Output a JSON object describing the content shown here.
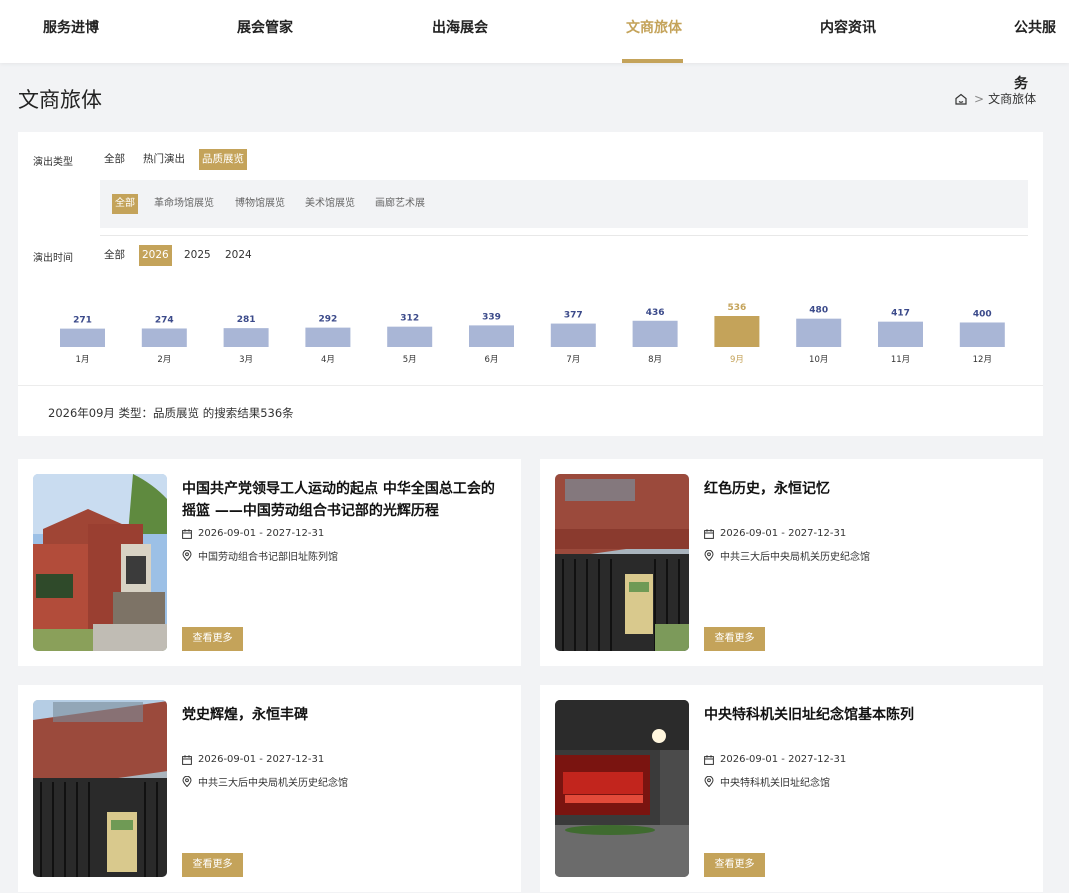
{
  "nav": {
    "items": [
      {
        "label": "服务进博",
        "active": false
      },
      {
        "label": "展会管家",
        "active": false
      },
      {
        "label": "出海展会",
        "active": false
      },
      {
        "label": "文商旅体",
        "active": true
      },
      {
        "label": "内容资讯",
        "active": false
      },
      {
        "label": "公共服务",
        "active": false
      }
    ]
  },
  "page": {
    "title": "文商旅体",
    "breadcrumb": {
      "current": "文商旅体",
      "separator": ">"
    }
  },
  "filters": {
    "type_label": "演出类型",
    "type_options": [
      {
        "label": "全部",
        "active": false
      },
      {
        "label": "热门演出",
        "active": false
      },
      {
        "label": "品质展览",
        "active": true
      }
    ],
    "sub_options": [
      {
        "label": "全部",
        "active": true
      },
      {
        "label": "革命场馆展览",
        "active": false
      },
      {
        "label": "博物馆展览",
        "active": false
      },
      {
        "label": "美术馆展览",
        "active": false
      },
      {
        "label": "画廊艺术展",
        "active": false
      }
    ],
    "time_label": "演出时间",
    "time_options": [
      {
        "label": "全部",
        "active": false
      },
      {
        "label": "2026",
        "active": true
      },
      {
        "label": "2025",
        "active": false
      },
      {
        "label": "2024",
        "active": false
      }
    ]
  },
  "chart_data": {
    "type": "bar",
    "categories": [
      "1月",
      "2月",
      "3月",
      "4月",
      "5月",
      "6月",
      "7月",
      "8月",
      "9月",
      "10月",
      "11月",
      "12月"
    ],
    "values": [
      271,
      274,
      281,
      292,
      312,
      339,
      377,
      436,
      536,
      480,
      417,
      400
    ],
    "selected": "9月",
    "colors": {
      "default": "#a9b6d6",
      "selected": "#c4a35a",
      "default_label": "#3b4a8a",
      "selected_label": "#c4a35a"
    }
  },
  "result": {
    "text": "2026年09月 类型：品质展览 的搜索结果536条"
  },
  "cards": [
    {
      "title": "中国共产党领导工人运动的起点 中华全国总工会的摇篮 ——中国劳动组合书记部的光辉历程",
      "date": "2026-09-01 - 2027-12-31",
      "venue": "中国劳动组合书记部旧址陈列馆",
      "button": "查看更多",
      "image": "red-brick-building-photo"
    },
    {
      "title": "红色历史，永恒记忆",
      "date": "2026-09-01 - 2027-12-31",
      "venue": "中共三大后中央局机关历史纪念馆",
      "button": "查看更多",
      "image": "memorial-gate-photo"
    },
    {
      "title": "党史辉煌，永恒丰碑",
      "date": "2026-09-01 - 2027-12-31",
      "venue": "中共三大后中央局机关历史纪念馆",
      "button": "查看更多",
      "image": "memorial-gate-photo"
    },
    {
      "title": "中央特科机关旧址纪念馆基本陈列",
      "date": "2026-09-01 - 2027-12-31",
      "venue": "中央特科机关旧址纪念馆",
      "button": "查看更多",
      "image": "exhibition-hall-photo"
    }
  ],
  "theme": {
    "accent": "#c4a35a",
    "background": "#f2f3f5"
  }
}
